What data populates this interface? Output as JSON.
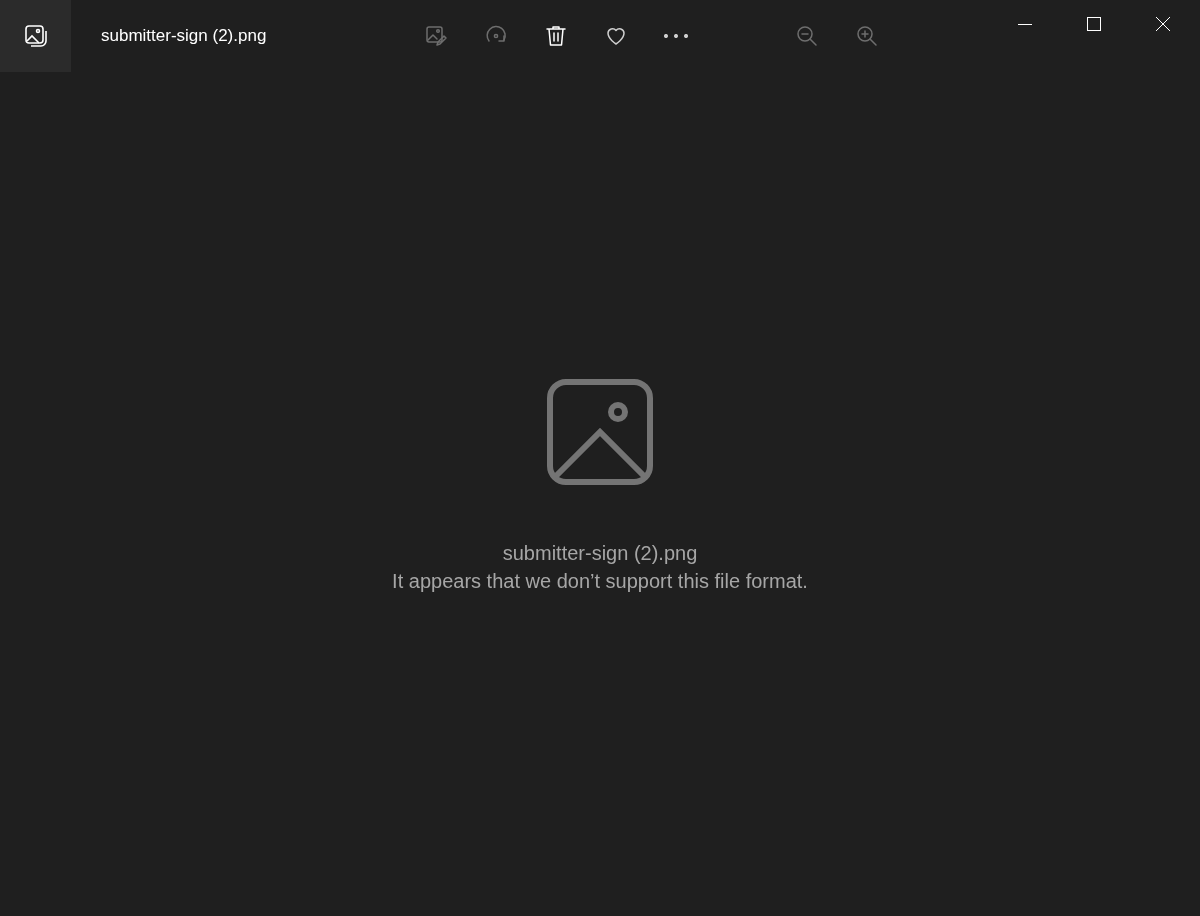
{
  "window": {
    "title": "submitter-sign (2).png"
  },
  "toolbar": [
    {
      "kind": "edit",
      "disabled": true
    },
    {
      "kind": "rotate",
      "disabled": true
    },
    {
      "kind": "delete",
      "disabled": false
    },
    {
      "kind": "favorite",
      "disabled": false
    },
    {
      "kind": "more",
      "disabled": false
    }
  ],
  "zoom_controls": [
    {
      "kind": "zoom-out",
      "disabled": true
    },
    {
      "kind": "zoom-in",
      "disabled": true
    }
  ],
  "message": {
    "file_name": "submitter-sign (2).png",
    "text": "It appears that we don’t support this file format."
  }
}
